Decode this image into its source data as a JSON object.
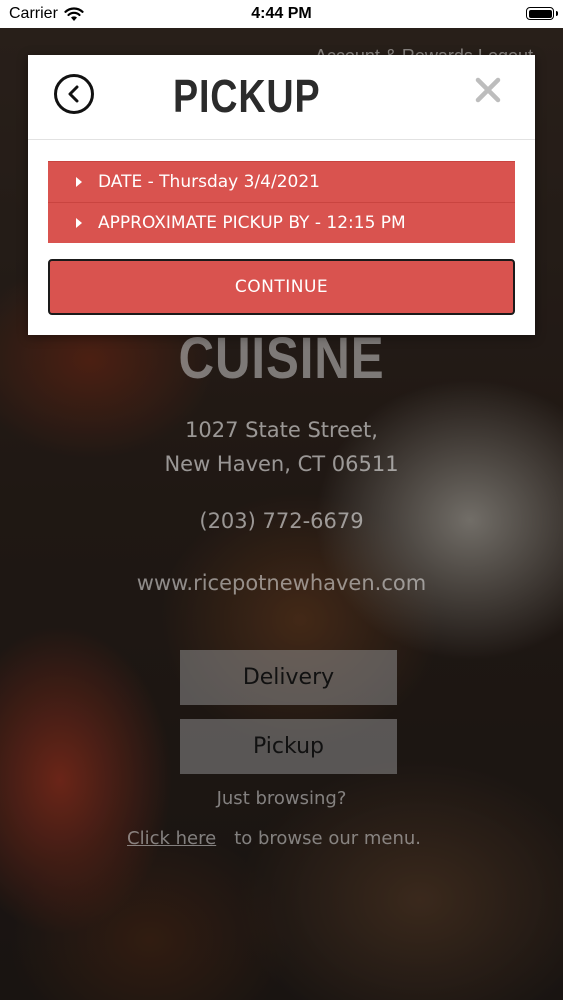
{
  "status_bar": {
    "carrier": "Carrier",
    "time": "4:44 PM"
  },
  "background": {
    "header_links": "Account & Rewards  Logout",
    "restaurant_name": "CUISINE",
    "address_line1": "1027 State Street,",
    "address_line2": "New Haven, CT 06511",
    "phone": "(203) 772-6679",
    "website": "www.ricepotnewhaven.com",
    "delivery_label": "Delivery",
    "pickup_label": "Pickup",
    "browsing_text": "Just browsing?",
    "click_here": "Click here",
    "browse_suffix": "to browse our menu."
  },
  "modal": {
    "title": "PICKUP",
    "date_row": "DATE - Thursday 3/4/2021",
    "time_row": "APPROXIMATE PICKUP BY - 12:15 PM",
    "continue_label": "CONTINUE"
  },
  "colors": {
    "accent": "#d9534f",
    "title": "#2b2b2b"
  }
}
